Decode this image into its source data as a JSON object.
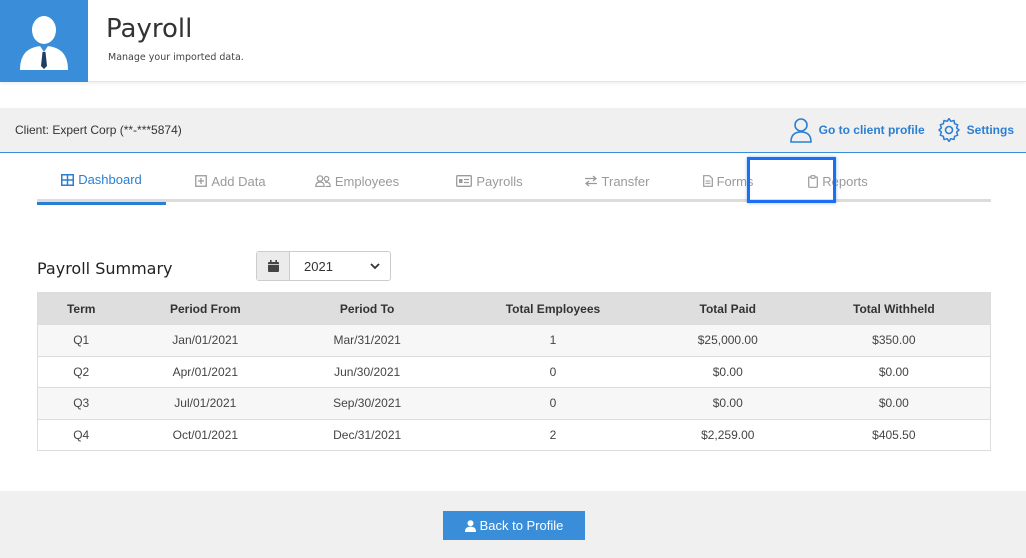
{
  "header": {
    "title": "Payroll",
    "subtitle": "Manage your imported data."
  },
  "client_bar": {
    "label": "Client: Expert Corp (**-***5874)",
    "profile_link": "Go to client profile",
    "settings_link": "Settings"
  },
  "tabs": [
    {
      "label": "Dashboard",
      "icon": "table-icon",
      "active": true
    },
    {
      "label": "Add Data",
      "icon": "plus-square-icon"
    },
    {
      "label": "Employees",
      "icon": "users-icon"
    },
    {
      "label": "Payrolls",
      "icon": "id-card-icon"
    },
    {
      "label": "Transfer",
      "icon": "exchange-icon"
    },
    {
      "label": "Forms",
      "icon": "document-icon"
    },
    {
      "label": "Reports",
      "icon": "clipboard-icon"
    }
  ],
  "summary": {
    "title": "Payroll Summary",
    "year": "2021",
    "columns": [
      "Term",
      "Period From",
      "Period To",
      "Total Employees",
      "Total Paid",
      "Total Withheld"
    ],
    "rows": [
      [
        "Q1",
        "Jan/01/2021",
        "Mar/31/2021",
        "1",
        "$25,000.00",
        "$350.00"
      ],
      [
        "Q2",
        "Apr/01/2021",
        "Jun/30/2021",
        "0",
        "$0.00",
        "$0.00"
      ],
      [
        "Q3",
        "Jul/01/2021",
        "Sep/30/2021",
        "0",
        "$0.00",
        "$0.00"
      ],
      [
        "Q4",
        "Oct/01/2021",
        "Dec/31/2021",
        "2",
        "$2,259.00",
        "$405.50"
      ]
    ]
  },
  "footer": {
    "back_label": "Back to Profile"
  },
  "colors": {
    "accent": "#3a8ed9",
    "highlight": "#1b6ff0"
  }
}
